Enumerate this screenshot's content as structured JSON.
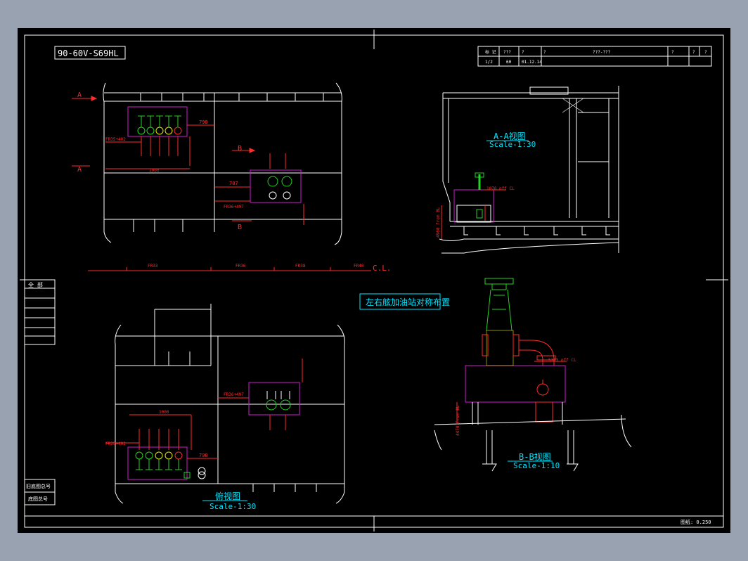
{
  "drawing": {
    "code": "90-60V-S69HL",
    "title_note": "左右舷加油站对称布置",
    "total_label": "全  部",
    "bottom_left_label_1": "旧底图总号",
    "bottom_left_label_2": "底图总号",
    "scale_status": "图纸: 0.250"
  },
  "title_block": {
    "r1": [
      "标 记",
      "???",
      "?",
      "?",
      "???-???",
      "?",
      "?",
      "?"
    ],
    "r2": [
      "1/2",
      "60",
      "01.12.14"
    ]
  },
  "views": {
    "aa_title": "A-A视图",
    "aa_scale": "Scale-1:30",
    "bb_title": "B-B视图",
    "bb_scale": "Scale-1:10",
    "top_title": "俯视图",
    "top_scale": "Scale-1:30"
  },
  "labels": {
    "sec_a": "A",
    "sec_b": "B",
    "cl": "C.L.",
    "fr_marks": [
      "FR33",
      "FR36",
      "FR38",
      "FR40"
    ],
    "dim_798": "798",
    "dim_707": "707",
    "dim_1475": "1475 off C.L.",
    "dim_1000": "1000",
    "fr_top_1": "FR35+402",
    "fr_top_2": "FR36+497",
    "fr_bot_1": "FR35+402",
    "fr_bot_2": "FR36+497",
    "dim_5315": "5315 off C.L.",
    "dim_3525": "3525 off C.L.",
    "dim_aa_1": "1070 off CL",
    "dim_aa_2": "4960 from BL",
    "dim_bb_1": "5315 off CL",
    "dim_bb_2": "4470 from BL",
    "dim_v1": "1000",
    "dim_v2": "350"
  },
  "colors": {
    "line": "#ffffff",
    "dim": "#ff2a2a",
    "cyan": "#00e5ff",
    "magenta": "#d01ad0",
    "green": "#25d225",
    "yellow": "#e8e800",
    "frame_bg": "#000000"
  }
}
